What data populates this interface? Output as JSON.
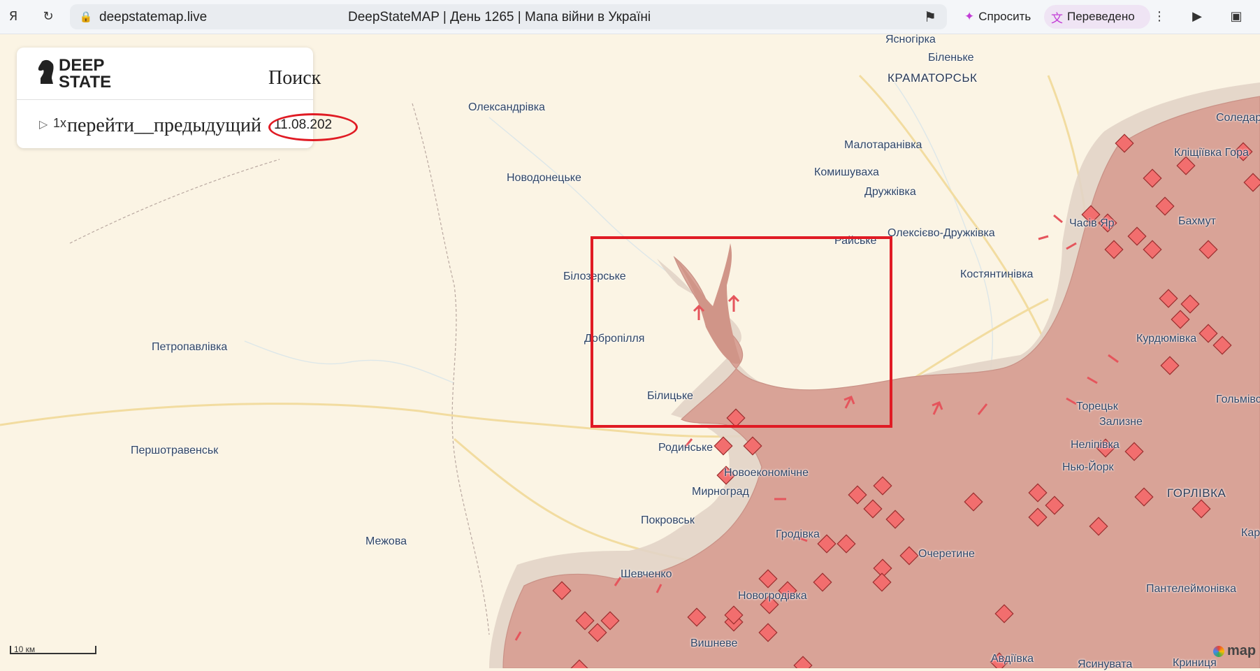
{
  "browser": {
    "url": "deepstatemap.live",
    "page_title": "DeepStateMAP | День 1265 | Мапа війни в Україні",
    "ask_label": "Спросить",
    "translated_label": "Переведено",
    "more_icon": "more-vertical-icon"
  },
  "panel": {
    "logo_line1": "DEEP",
    "logo_line2": "STATE",
    "search_label": "Поиск",
    "speed": "1x",
    "goto_label": "перейти__предыдущий",
    "date_value": "11.08.202"
  },
  "scale": {
    "label": "10 км"
  },
  "attribution": {
    "logo": "map"
  },
  "places": [
    {
      "name": "Ясногірка"
    },
    {
      "name": "Біленьке"
    },
    {
      "name": "КРАМАТОРСЬК"
    },
    {
      "name": "Олександрівка"
    },
    {
      "name": "Малотаранівка"
    },
    {
      "name": "Комишуваха"
    },
    {
      "name": "Новодонецьке"
    },
    {
      "name": "Дружківка"
    },
    {
      "name": "Райське"
    },
    {
      "name": "Олексієво-Дружківка"
    },
    {
      "name": "Білозерське"
    },
    {
      "name": "Костянтинівка"
    },
    {
      "name": "Часів Яр"
    },
    {
      "name": "Бахмут"
    },
    {
      "name": "Соледар"
    },
    {
      "name": "Кліщіївка Гора"
    },
    {
      "name": "Добропілля"
    },
    {
      "name": "Петропавлівка"
    },
    {
      "name": "Курдюмівка"
    },
    {
      "name": "Білицьке"
    },
    {
      "name": "Гольмівс"
    },
    {
      "name": "Торецьк"
    },
    {
      "name": "Зализне"
    },
    {
      "name": "Першотравенськ"
    },
    {
      "name": "Родинське"
    },
    {
      "name": "Неліпівка"
    },
    {
      "name": "Нью-Йорк"
    },
    {
      "name": "Новоекономічне"
    },
    {
      "name": "Мирноград"
    },
    {
      "name": "ГОРЛІВКА"
    },
    {
      "name": "Покровськ"
    },
    {
      "name": "Межова"
    },
    {
      "name": "Гродівка"
    },
    {
      "name": "Очеретине"
    },
    {
      "name": "Шевченко"
    },
    {
      "name": "Новогродівка"
    },
    {
      "name": "Пантелеймонівка"
    },
    {
      "name": "Вишневе"
    },
    {
      "name": "Авдіївка"
    },
    {
      "name": "Ясинувата"
    },
    {
      "name": "Криниця"
    },
    {
      "name": "Кар"
    }
  ],
  "colors": {
    "occupied": "#d9a397",
    "occupied_edge": "#c99186",
    "gray_zone": "#d4c9bd",
    "crimea_dpr": "#c8a6c0",
    "annotation": "#e01b24",
    "marker": "#f26e6e"
  }
}
